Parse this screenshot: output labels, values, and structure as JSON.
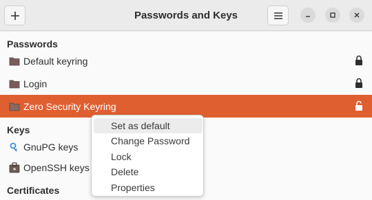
{
  "window": {
    "title": "Passwords and Keys"
  },
  "sections": {
    "passwords": "Passwords",
    "keys": "Keys",
    "certificates": "Certificates"
  },
  "passwords_items": [
    {
      "label": "Default keyring",
      "icon": "folder-icon",
      "locked": true
    },
    {
      "label": "Login",
      "icon": "folder-icon",
      "locked": true
    },
    {
      "label": "Zero Security Keyring",
      "icon": "folder-icon",
      "locked": false,
      "selected": true
    }
  ],
  "keys_items": [
    {
      "label": "GnuPG keys",
      "icon": "gnupg-key-icon"
    },
    {
      "label": "OpenSSH keys",
      "icon": "ssh-key-icon"
    }
  ],
  "context_menu": [
    {
      "label": "Set as default"
    },
    {
      "label": "Change Password"
    },
    {
      "label": "Lock"
    },
    {
      "label": "Delete"
    },
    {
      "label": "Properties"
    }
  ],
  "colors": {
    "accent": "#e05f31",
    "background": "#fafafa",
    "headerbar": "#ebebeb"
  }
}
